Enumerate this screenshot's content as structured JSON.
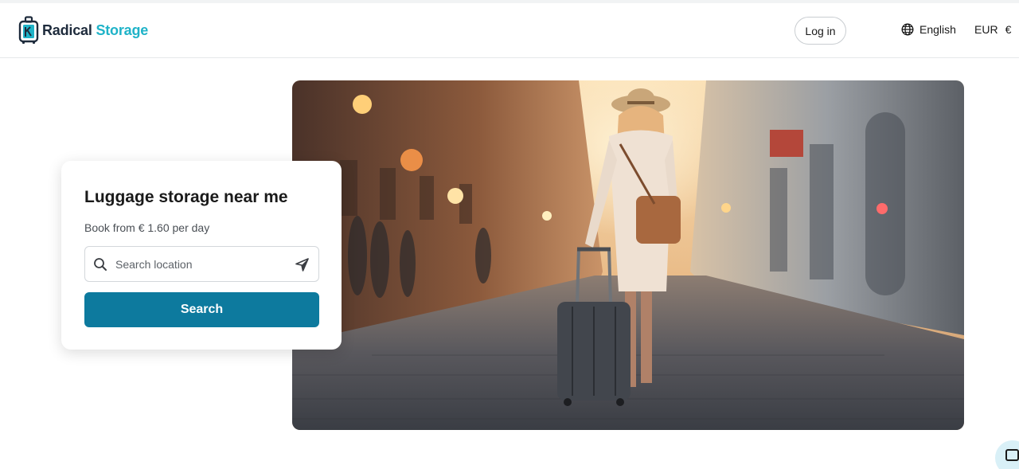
{
  "brand": {
    "name_part1": "Radical",
    "name_part2": "Storage",
    "primary_color": "#0d7a9e",
    "accent_color": "#1fb3c8"
  },
  "header": {
    "login_label": "Log in",
    "language_label": "English",
    "currency_code": "EUR",
    "currency_symbol": "€"
  },
  "hero_card": {
    "title": "Luggage storage near me",
    "subtitle": "Book from € 1.60 per day",
    "search_placeholder": "Search location",
    "search_value": "",
    "search_button_label": "Search"
  },
  "icons": {
    "search": "search-icon",
    "location": "location-arrow-icon",
    "language": "globe-icon",
    "chat": "chat-icon"
  }
}
